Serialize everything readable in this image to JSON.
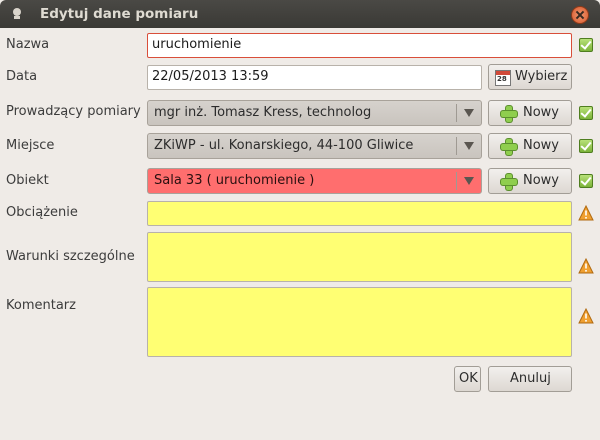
{
  "window": {
    "title": "Edytuj dane pomiaru"
  },
  "fields": {
    "nazwa": {
      "label": "Nazwa",
      "value": "uruchomienie"
    },
    "data": {
      "label": "Data",
      "value": "22/05/2013 13:59",
      "button_label": "Wybierz",
      "calendar_day": "28"
    },
    "prowadzacy": {
      "label": "Prowadzący pomiary",
      "value": "mgr inż. Tomasz Kress, technolog",
      "button_label": "Nowy"
    },
    "miejsce": {
      "label": "Miejsce",
      "value": "ZKiWP - ul. Konarskiego, 44-100 Gliwice",
      "button_label": "Nowy"
    },
    "obiekt": {
      "label": "Obiekt",
      "value": "Sala 33 ( uruchomienie )",
      "button_label": "Nowy"
    },
    "obciazenie": {
      "label": "Obciążenie",
      "value": ""
    },
    "warunki": {
      "label": "Warunki szczególne",
      "value": ""
    },
    "komentarz": {
      "label": "Komentarz",
      "value": ""
    }
  },
  "buttons": {
    "ok": "OK",
    "cancel": "Anuluj"
  },
  "colors": {
    "required_empty": "#ffff73",
    "invalid": "#ff6e6e",
    "valid_check": "#7cb33a",
    "warning": "#f0a030"
  },
  "icons": {
    "valid": "checkmark-icon",
    "warning": "warning-triangle-icon",
    "add": "plus-icon",
    "calendar": "calendar-icon"
  }
}
